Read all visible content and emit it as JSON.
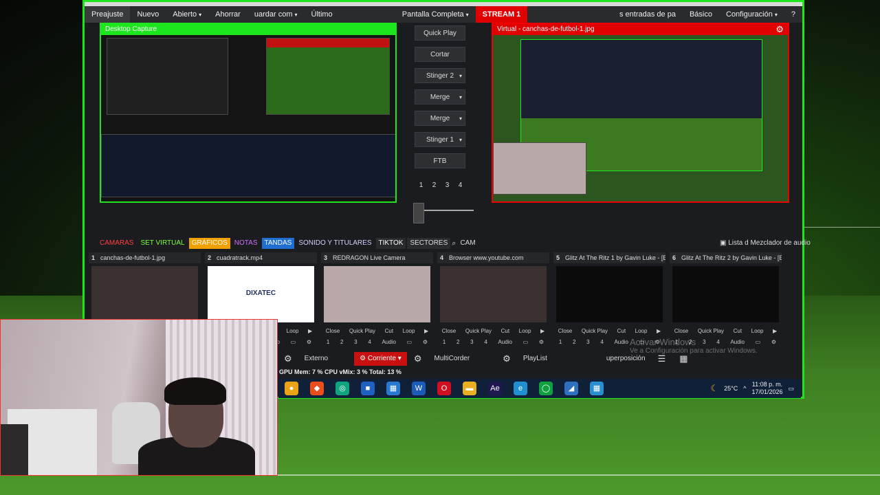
{
  "menubar": {
    "items": [
      {
        "label": "Preajuste",
        "caret": false
      },
      {
        "label": "Nuevo",
        "caret": false
      },
      {
        "label": "Abierto",
        "caret": true
      },
      {
        "label": "Ahorrar",
        "caret": false
      },
      {
        "label": "uardar com",
        "caret": true
      },
      {
        "label": "Último",
        "caret": false
      }
    ],
    "fullscreen": "Pantalla Completa",
    "stream": "STREAM 1",
    "entradas": "s entradas de pa",
    "basico": "Básico",
    "config": "Configuración",
    "help": "?"
  },
  "preview": {
    "left_title": "Desktop Capture",
    "right_title": "Virtual - canchas-de-futbol-1.jpg"
  },
  "transitions": {
    "buttons": [
      {
        "label": "Quick Play",
        "dropdown": false
      },
      {
        "label": "Cortar",
        "dropdown": false
      },
      {
        "label": "Stinger 2",
        "dropdown": true
      },
      {
        "label": "Merge",
        "dropdown": true
      },
      {
        "label": "Merge",
        "dropdown": true
      },
      {
        "label": "Stinger 1",
        "dropdown": true
      },
      {
        "label": "FTB",
        "dropdown": false
      }
    ],
    "numbers": [
      "1",
      "2",
      "3",
      "4"
    ]
  },
  "tabs": [
    {
      "label": "CAMARAS",
      "bg": "#1b1c1f",
      "fg": "#ff4040"
    },
    {
      "label": "SET VIRTUAL",
      "bg": "#1b1c1f",
      "fg": "#7cff3a"
    },
    {
      "label": "GRÁFICOS",
      "bg": "#f0a000",
      "fg": "#ffffff"
    },
    {
      "label": "NOTAS",
      "bg": "#1b1c1f",
      "fg": "#d070ff"
    },
    {
      "label": "TANDAS",
      "bg": "#1f6fd0",
      "fg": "#ffffff"
    },
    {
      "label": "SONIDO Y TITULARES",
      "bg": "#1b1c1f",
      "fg": "#d0d0ff"
    },
    {
      "label": "TIKTOK",
      "bg": "#2a2b2e",
      "fg": "#ffffff"
    },
    {
      "label": "SECTORES",
      "bg": "#2a2b2e",
      "fg": "#dddddd"
    },
    {
      "label": "CAM",
      "bg": "#1b1c1f",
      "fg": "#dddddd"
    }
  ],
  "right_tab": "Lista d Mezclador de audio",
  "inputs": [
    {
      "num": "1",
      "title": "canchas-de-futbol-1.jpg",
      "thumb": "#3a3030"
    },
    {
      "num": "2",
      "title": "cuadratrack.mp4",
      "thumb": "#ffffff",
      "logo": "DIXATEC"
    },
    {
      "num": "3",
      "title": "REDRAGON Live Camera",
      "thumb": "#b8a8a8"
    },
    {
      "num": "4",
      "title": "Browser www.youtube.com",
      "thumb": "#3a3030"
    },
    {
      "num": "5",
      "title": "Glitz At The Ritz 1 by Gavin Luke - [E",
      "thumb": "#0b0b0b"
    },
    {
      "num": "6",
      "title": "Glitz At The Ritz 2 by Gavin Luke - [E",
      "thumb": "#0b0b0b"
    }
  ],
  "input_controls": {
    "close": "Close",
    "quick": "Quick Play",
    "cut": "Cut",
    "loop": "Loop",
    "audio": "Audio",
    "n1": "1",
    "n2": "2",
    "n3": "3",
    "n4": "4"
  },
  "bottombar": {
    "externo": "Externo",
    "corriente": "Corriente",
    "multicorder": "MultiCorder",
    "playlist": "PlayList",
    "superposicion": "uperposición"
  },
  "status": "GPU Mem:  7 %  CPU vMix:  3 %  Total:  13 %",
  "taskbar": {
    "temp": "25°C",
    "time": "11:08 p. m.",
    "date": "17/01/2026",
    "icons": [
      {
        "name": "chrome-icon",
        "color": "#e8a317",
        "glyph": "●"
      },
      {
        "name": "colorful-app-icon",
        "color": "#e94e1b",
        "glyph": "◆"
      },
      {
        "name": "clipchamp-icon",
        "color": "#0fa37f",
        "glyph": "◎"
      },
      {
        "name": "app-blue-icon",
        "color": "#2060c0",
        "glyph": "■"
      },
      {
        "name": "store-icon",
        "color": "#2878d0",
        "glyph": "▦"
      },
      {
        "name": "word-icon",
        "color": "#1d5bb8",
        "glyph": "W"
      },
      {
        "name": "opera-icon",
        "color": "#d01020",
        "glyph": "O"
      },
      {
        "name": "explorer-icon",
        "color": "#e8b020",
        "glyph": "▬"
      },
      {
        "name": "after-effects-icon",
        "color": "#201850",
        "glyph": "Ae"
      },
      {
        "name": "edge-icon",
        "color": "#1f8fd0",
        "glyph": "e"
      },
      {
        "name": "spotify-like-icon",
        "color": "#10a040",
        "glyph": "◯"
      },
      {
        "name": "vmix-icon",
        "color": "#3070c0",
        "glyph": "◢"
      },
      {
        "name": "grid-app-icon",
        "color": "#2a8fd0",
        "glyph": "▦"
      }
    ]
  },
  "watermark": {
    "line1": "Activar Windows",
    "line2": "Ve a Configuración para activar Windows."
  }
}
